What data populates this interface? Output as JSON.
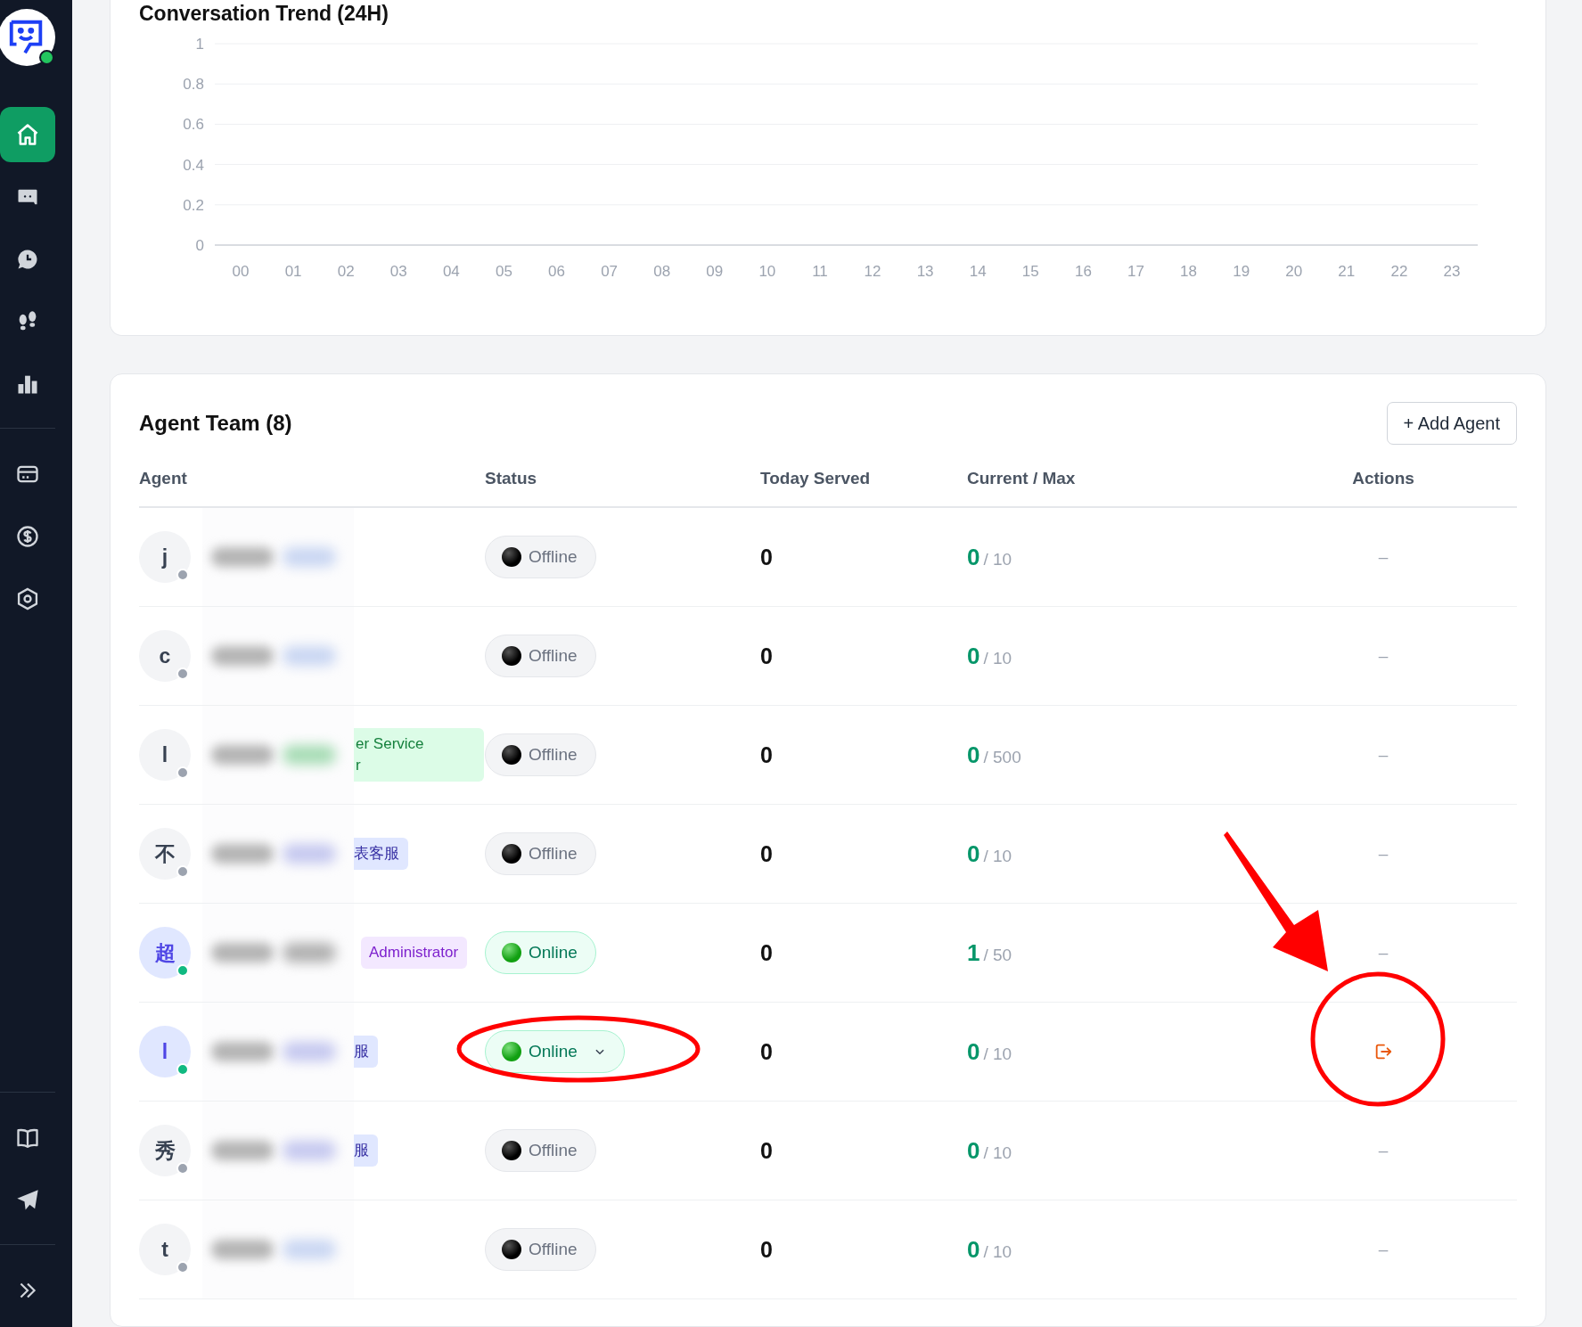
{
  "sidebar": {
    "logo_online": true,
    "items": [
      {
        "selected": true
      },
      {
        "selected": false
      },
      {
        "selected": false
      },
      {
        "selected": false
      },
      {
        "selected": false
      },
      {
        "selected": false
      },
      {
        "selected": false
      },
      {
        "selected": false
      }
    ],
    "bottom_items": [
      {
        "selected": false
      },
      {
        "selected": false
      }
    ]
  },
  "trend_card": {
    "title": "Conversation Trend (24H)",
    "chart_data": {
      "type": "line",
      "grid": true,
      "ylim": [
        0,
        1
      ],
      "yticks": [
        0,
        {
          "value": 0.2,
          "label": "0.2"
        },
        {
          "value": 0.4,
          "label": "0.4"
        },
        {
          "value": 0.6,
          "label": "0.6"
        },
        {
          "value": 0.8,
          "label": "0.8"
        },
        1
      ],
      "categories": [
        "00",
        "01",
        "02",
        "03",
        "04",
        "05",
        "06",
        "07",
        "08",
        "09",
        "10",
        "11",
        "12",
        "13",
        "14",
        "15",
        "16",
        "17",
        "18",
        "19",
        "20",
        "21",
        "22",
        "23"
      ]
    }
  },
  "agent_team": {
    "title": "Agent Team (8)",
    "add_button": "+ Add Agent",
    "columns": [
      "Agent",
      "Status",
      "Today Served",
      "Current / Max",
      "Actions"
    ],
    "rows": [
      {
        "avatar": "j",
        "online": false,
        "status": "Offline",
        "dropdown": false,
        "today_served": "0",
        "current": "0",
        "max": "/ 10",
        "action": "–"
      },
      {
        "avatar": "c",
        "online": false,
        "status": "Offline",
        "dropdown": false,
        "today_served": "0",
        "current": "0",
        "max": "/ 10",
        "action": "–"
      },
      {
        "avatar": "l",
        "online": false,
        "tag": {
          "text": "er Service\nr",
          "kind": "service"
        },
        "status": "Offline",
        "dropdown": false,
        "today_served": "0",
        "current": "0",
        "max": "/ 500",
        "action": "–"
      },
      {
        "avatar": "不",
        "online": false,
        "tag": {
          "text": "表客服",
          "kind": "team"
        },
        "status": "Offline",
        "dropdown": false,
        "today_served": "0",
        "current": "0",
        "max": "/ 10",
        "action": "–"
      },
      {
        "avatar": "超",
        "online": true,
        "tag": {
          "text": "Administrator",
          "kind": "admin"
        },
        "status": "Online",
        "dropdown": false,
        "today_served": "0",
        "current": "1",
        "max": "/ 50",
        "action": "–"
      },
      {
        "avatar": "l",
        "online": true,
        "tag": {
          "text": "服",
          "kind": "team"
        },
        "status": "Online",
        "dropdown": true,
        "today_served": "0",
        "current": "0",
        "max": "/ 10",
        "action": {
          "kind": "logout"
        }
      },
      {
        "avatar": "秀",
        "online": false,
        "tag": {
          "text": "服",
          "kind": "team"
        },
        "status": "Offline",
        "dropdown": false,
        "today_served": "0",
        "current": "0",
        "max": "/ 10",
        "action": "–"
      },
      {
        "avatar": "t",
        "online": false,
        "status": "Offline",
        "dropdown": false,
        "today_served": "0",
        "current": "0",
        "max": "/ 10",
        "action": "–"
      }
    ]
  }
}
